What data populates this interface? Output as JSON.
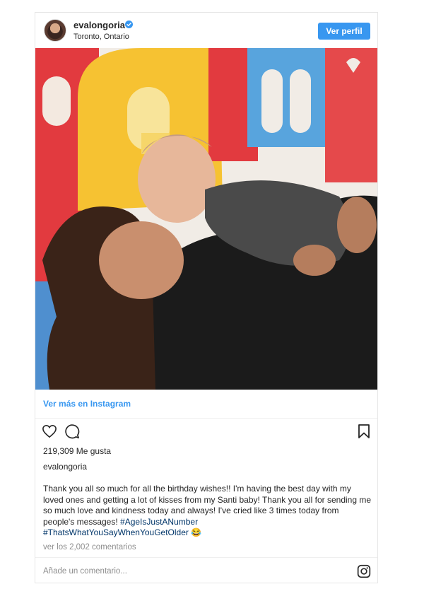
{
  "header": {
    "username": "evalongoria",
    "location": "Toronto, Ontario",
    "follow_label": "Ver perfil",
    "verified_icon": "verified-badge-icon"
  },
  "post": {
    "view_more_label": "Ver más en Instagram",
    "likes_text": "219,309 Me gusta",
    "caption_user": "evalongoria",
    "caption_text": "Thank you all so much for all the birthday wishes!! I'm having the best day with my loved ones and getting a lot of kisses from my Santi baby! Thank you all for sending me so much love and kindness today and always! I've cried like 3 times today from people's messages! ",
    "hashtags": [
      "#AgeIsJustANumber",
      "#ThatsWhatYouSayWhenYouGetOlder"
    ],
    "emoji": "😂",
    "comments_link": "ver los 2,002 comentarios",
    "comment_placeholder": "Añade un comentario..."
  },
  "colors": {
    "accent": "#3897f0",
    "hashtag": "#003569",
    "muted": "#8e8e8e",
    "border": "#e6e6e6"
  },
  "icons": [
    "heart-icon",
    "comment-icon",
    "bookmark-icon",
    "instagram-logo-icon"
  ]
}
